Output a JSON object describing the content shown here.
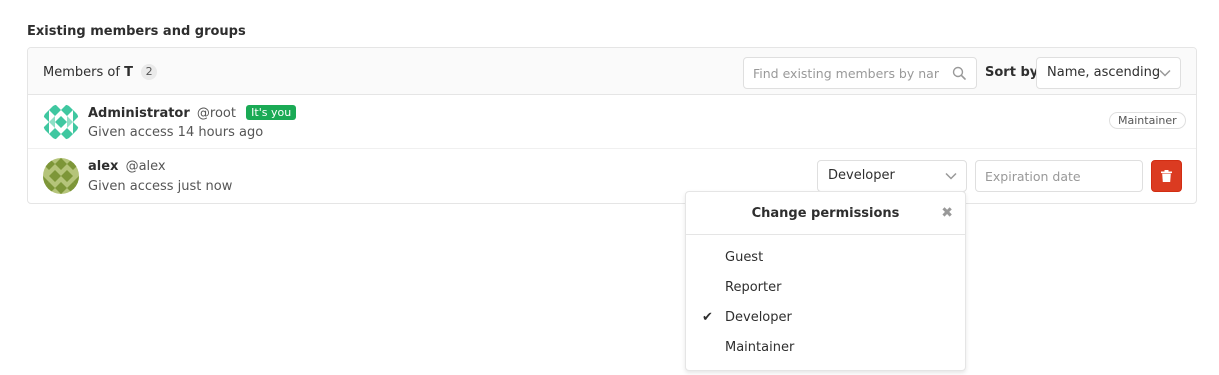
{
  "section_title": "Existing members and groups",
  "panel": {
    "members_of_prefix": "Members of",
    "group_name": "T",
    "member_count": "2",
    "search_placeholder": "Find existing members by name",
    "sort_label": "Sort by",
    "sort_value": "Name, ascending"
  },
  "members": [
    {
      "name": "Administrator",
      "username": "@root",
      "badge": "It's you",
      "access": "Given access 14 hours ago",
      "role": "Maintainer",
      "avatar_color": "#3fc7a0",
      "avatar_icon": "identicon"
    },
    {
      "name": "alex",
      "username": "@alex",
      "access": "Given access just now",
      "role": "Developer",
      "expiration_placeholder": "Expiration date",
      "avatar_color": "#7d9638",
      "avatar_icon": "identicon"
    }
  ],
  "permissions_dropdown": {
    "title": "Change permissions",
    "close_icon": "close-icon",
    "options": [
      "Guest",
      "Reporter",
      "Developer",
      "Maintainer"
    ],
    "selected": "Developer"
  },
  "colors": {
    "badge_green": "#1aaa55",
    "delete_red": "#db3b21"
  }
}
